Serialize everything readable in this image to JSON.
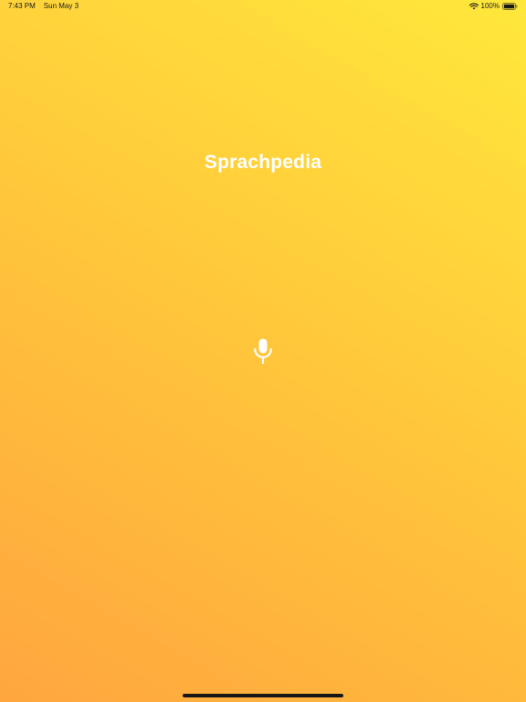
{
  "status_bar": {
    "time": "7:43 PM",
    "date": "Sun May 3",
    "battery_percent": "100%",
    "wifi_icon": "wifi-icon",
    "battery_icon": "battery-full-icon"
  },
  "app": {
    "title": "Sprachpedia",
    "mic_icon": "microphone-icon"
  },
  "colors": {
    "gradient_start": "#ffa63f",
    "gradient_mid": "#ffc23b",
    "gradient_end": "#ffe83b",
    "title_text": "#ffffff",
    "home_indicator": "#161616"
  }
}
